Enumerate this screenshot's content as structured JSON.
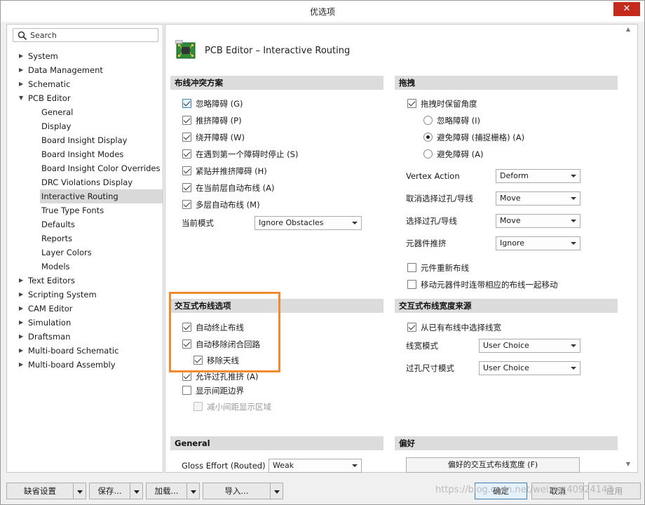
{
  "window": {
    "title": "优选项",
    "close_label": "✕"
  },
  "search": {
    "placeholder": "Search"
  },
  "tree": [
    {
      "label": "System",
      "level": 0,
      "expander": "right"
    },
    {
      "label": "Data Management",
      "level": 0,
      "expander": "right"
    },
    {
      "label": "Schematic",
      "level": 0,
      "expander": "right"
    },
    {
      "label": "PCB Editor",
      "level": 0,
      "expander": "down"
    },
    {
      "label": "General",
      "level": 1
    },
    {
      "label": "Display",
      "level": 1
    },
    {
      "label": "Board Insight Display",
      "level": 1
    },
    {
      "label": "Board Insight Modes",
      "level": 1
    },
    {
      "label": "Board Insight Color Overrides",
      "level": 1
    },
    {
      "label": "DRC Violations Display",
      "level": 1
    },
    {
      "label": "Interactive Routing",
      "level": 1,
      "selected": true
    },
    {
      "label": "True Type Fonts",
      "level": 1
    },
    {
      "label": "Defaults",
      "level": 1
    },
    {
      "label": "Reports",
      "level": 1
    },
    {
      "label": "Layer Colors",
      "level": 1
    },
    {
      "label": "Models",
      "level": 1
    },
    {
      "label": "Text Editors",
      "level": 0,
      "expander": "right"
    },
    {
      "label": "Scripting System",
      "level": 0,
      "expander": "right"
    },
    {
      "label": "CAM Editor",
      "level": 0,
      "expander": "right"
    },
    {
      "label": "Simulation",
      "level": 0,
      "expander": "right"
    },
    {
      "label": "Draftsman",
      "level": 0,
      "expander": "right"
    },
    {
      "label": "Multi-board Schematic",
      "level": 0,
      "expander": "right"
    },
    {
      "label": "Multi-board Assembly",
      "level": 0,
      "expander": "right"
    }
  ],
  "page": {
    "title": "PCB Editor – Interactive Routing"
  },
  "conflict": {
    "header": "布线冲突方案",
    "options": [
      {
        "label": "忽略障碍 (G)",
        "checked": true,
        "focus": true
      },
      {
        "label": "推挤障碍 (P)",
        "checked": true
      },
      {
        "label": "绕开障碍 (W)",
        "checked": true
      },
      {
        "label": "在遇到第一个障碍时停止 (S)",
        "checked": true
      },
      {
        "label": "紧贴并推挤障碍 (H)",
        "checked": true
      },
      {
        "label": "在当前层自动布线 (A)",
        "checked": true
      },
      {
        "label": "多层自动布线 (M)",
        "checked": true
      }
    ],
    "mode_label": "当前模式",
    "mode_value": "Ignore Obstacles"
  },
  "drag": {
    "header": "拖拽",
    "preserve_angle": {
      "label": "拖拽时保留角度",
      "checked": true
    },
    "radios": [
      {
        "label": "忽略障碍 (I)",
        "selected": false
      },
      {
        "label": "避免障碍 (捕捉栅格) (A)",
        "selected": true
      },
      {
        "label": "避免障碍 (A)",
        "selected": false
      }
    ],
    "fields": [
      {
        "label": "Vertex Action",
        "value": "Deform"
      },
      {
        "label": "取消选择过孔/导线",
        "value": "Move"
      },
      {
        "label": "选择过孔/导线",
        "value": "Move"
      },
      {
        "label": "元器件推挤",
        "value": "Ignore"
      }
    ],
    "reroute": {
      "label": "元件重新布线",
      "checked": false
    },
    "move_with": {
      "label": "移动元器件时连带相应的布线一起移动",
      "checked": false
    }
  },
  "interactive": {
    "header": "交互式布线选项",
    "options": [
      {
        "label": "自动终止布线",
        "checked": true,
        "indent": false,
        "disabled": false
      },
      {
        "label": "自动移除闭合回路",
        "checked": true,
        "indent": false,
        "disabled": false
      },
      {
        "label": "移除天线",
        "checked": true,
        "indent": true,
        "disabled": false
      },
      {
        "label": "允许过孔推挤 (A)",
        "checked": true,
        "indent": false,
        "disabled": false
      },
      {
        "label": "显示间距边界",
        "checked": false,
        "indent": false,
        "disabled": false
      },
      {
        "label": "减小间距显示区域",
        "checked": false,
        "indent": true,
        "disabled": true
      }
    ]
  },
  "width_source": {
    "header": "交互式布线宽度来源",
    "pick_existing": {
      "label": "从已有布线中选择线宽",
      "checked": true
    },
    "fields": [
      {
        "label": "线宽模式",
        "value": "User Choice"
      },
      {
        "label": "过孔尺寸模式",
        "value": "User Choice"
      }
    ]
  },
  "general": {
    "header": "General",
    "gloss_label": "Gloss Effort (Routed)",
    "gloss_value": "Weak"
  },
  "favorites": {
    "header": "偏好",
    "button": "偏好的交互式布线宽度 (F)"
  },
  "bottom": {
    "defaults": "缺省设置",
    "save": "保存...",
    "load": "加载...",
    "import": "导入...",
    "ok": "确定",
    "cancel": "取消",
    "apply": "应用"
  },
  "watermark": "https://blog.csdn.net/weixin_40924143"
}
